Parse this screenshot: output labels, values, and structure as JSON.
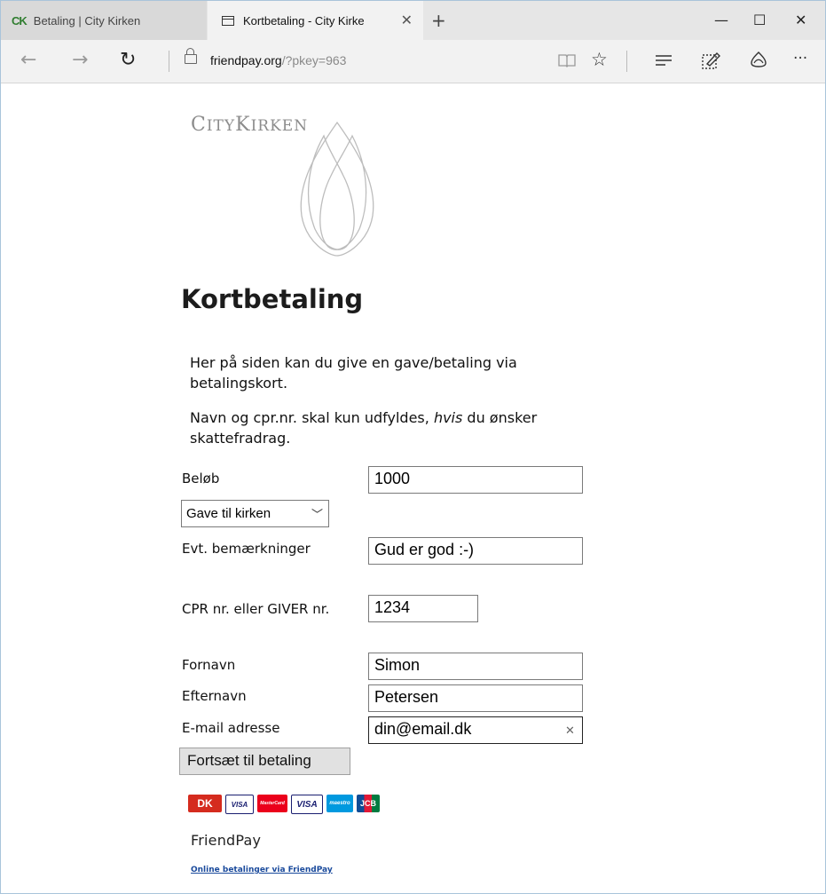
{
  "browser": {
    "tabs": [
      {
        "title": "Betaling | City Kirken",
        "icon": "ck-logo-icon",
        "icon_text": "CK"
      },
      {
        "title": "Kortbetaling - City Kirke",
        "icon": "page-icon"
      }
    ],
    "new_tab_glyph": "+",
    "window_controls": {
      "minimize": "—",
      "maximize": "☐",
      "close": "✕"
    },
    "address": {
      "host": "friendpay.org",
      "query": "/?pkey=963"
    },
    "nav": {
      "back": "←",
      "forward": "→",
      "refresh": "↻"
    },
    "toolbar_icons": [
      "reading-view-icon",
      "favorite-star-icon",
      "hub-icon",
      "web-note-icon",
      "share-icon",
      "more-icon"
    ],
    "more_glyph": "···"
  },
  "page": {
    "logo": {
      "text": "CITYKIRKEN",
      "display_city": "C",
      "display_ity": "ITY",
      "display_k": "K",
      "display_irken": "IRKEN"
    },
    "heading": "Kortbetaling",
    "intro1": "Her på siden kan du give en gave/betaling via betalingskort.",
    "intro2_before": "Navn og cpr.nr. skal kun udfyldes, ",
    "intro2_em": "hvis",
    "intro2_after": " du ønsker skattefradrag.",
    "form": {
      "amount_label": "Beløb",
      "amount_value": "1000",
      "purpose_selected": "Gave til kirken",
      "remarks_label": "Evt. bemærkninger",
      "remarks_value": "Gud er god :-)",
      "cpr_label": "CPR nr. eller GIVER nr.",
      "cpr_value": "1234",
      "firstname_label": "Fornavn",
      "firstname_value": "Simon",
      "lastname_label": "Efternavn",
      "lastname_value": "Petersen",
      "email_label": "E-mail adresse",
      "email_value": "din@email.dk",
      "submit_label": "Fortsæt til betaling"
    },
    "card_logos": [
      {
        "name": "dankort",
        "text": "DK",
        "color": "#d52b1e"
      },
      {
        "name": "visa",
        "text": "VISA",
        "color": "#1a1f71"
      },
      {
        "name": "mastercard",
        "text": "MasterCard",
        "color": "#eb001b"
      },
      {
        "name": "visa-electron",
        "text": "VISA",
        "color": "#1a1f71"
      },
      {
        "name": "maestro",
        "text": "maestro",
        "color": "#0099df"
      },
      {
        "name": "jcb",
        "text": "JCB",
        "color": "#0e4c96"
      }
    ],
    "provider": "FriendPay",
    "provider_link": "Online betalinger via FriendPay"
  }
}
